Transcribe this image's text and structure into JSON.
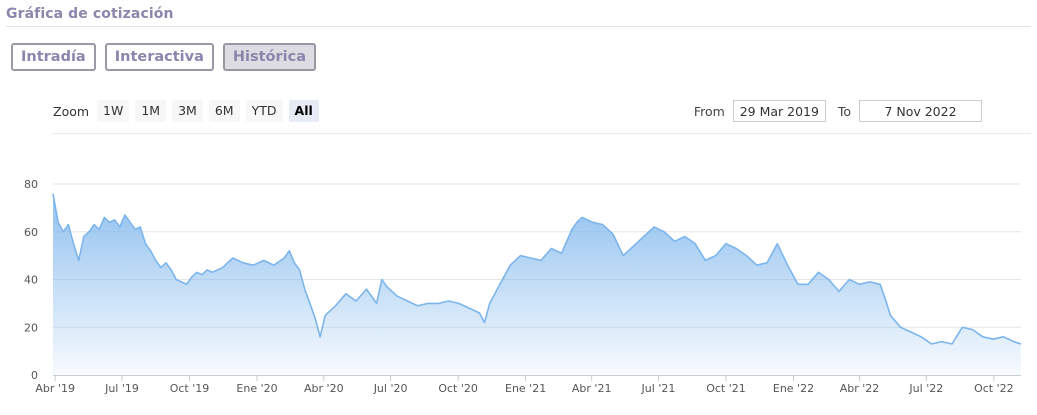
{
  "header": {
    "title": "Gráfica de cotización"
  },
  "tabs": [
    {
      "label": "Intradía",
      "active": false
    },
    {
      "label": "Interactiva",
      "active": false
    },
    {
      "label": "Histórica",
      "active": true
    }
  ],
  "range_selector": {
    "zoom_label": "Zoom",
    "buttons": [
      "1W",
      "1M",
      "3M",
      "6M",
      "YTD",
      "All"
    ],
    "active": "All",
    "from_label": "From",
    "from_value": "29 Mar 2019",
    "to_label": "To",
    "to_value": "7 Nov 2022"
  },
  "colors": {
    "line": "#7cb5ec",
    "fill_top": "#7cb5ec",
    "grid": "#e6e6e6",
    "accent": "#8c86ad"
  },
  "chart_data": {
    "type": "area",
    "title": "",
    "xlabel": "",
    "ylabel": "",
    "ylim": [
      0,
      80
    ],
    "yticks": [
      0,
      20,
      40,
      60,
      80
    ],
    "grid": true,
    "xlim": [
      "2019-03-29",
      "2022-11-07"
    ],
    "xticks": [
      {
        "date": "2019-04-01",
        "label": "Abr '19"
      },
      {
        "date": "2019-07-01",
        "label": "Jul '19"
      },
      {
        "date": "2019-10-01",
        "label": "Oct '19"
      },
      {
        "date": "2020-01-01",
        "label": "Ene '20"
      },
      {
        "date": "2020-04-01",
        "label": "Abr '20"
      },
      {
        "date": "2020-07-01",
        "label": "Jul '20"
      },
      {
        "date": "2020-10-01",
        "label": "Oct '20"
      },
      {
        "date": "2021-01-01",
        "label": "Ene '21"
      },
      {
        "date": "2021-04-01",
        "label": "Abr '21"
      },
      {
        "date": "2021-07-01",
        "label": "Jul '21"
      },
      {
        "date": "2021-10-01",
        "label": "Oct '21"
      },
      {
        "date": "2022-01-01",
        "label": "Ene '22"
      },
      {
        "date": "2022-04-01",
        "label": "Abr '22"
      },
      {
        "date": "2022-07-01",
        "label": "Jul '22"
      },
      {
        "date": "2022-10-01",
        "label": "Oct '22"
      }
    ],
    "series": [
      {
        "x": [
          "2019-03-29",
          "2019-04-05",
          "2019-04-12",
          "2019-04-19",
          "2019-04-26",
          "2019-05-03",
          "2019-05-10",
          "2019-05-17",
          "2019-05-24",
          "2019-05-31",
          "2019-06-07",
          "2019-06-14",
          "2019-06-21",
          "2019-06-28",
          "2019-07-05",
          "2019-07-12",
          "2019-07-19",
          "2019-07-26",
          "2019-08-02",
          "2019-08-09",
          "2019-08-16",
          "2019-08-23",
          "2019-08-30",
          "2019-09-06",
          "2019-09-13",
          "2019-09-20",
          "2019-09-27",
          "2019-10-04",
          "2019-10-11",
          "2019-10-18",
          "2019-10-25",
          "2019-11-01",
          "2019-11-15",
          "2019-11-29",
          "2019-12-13",
          "2019-12-27",
          "2020-01-10",
          "2020-01-24",
          "2020-02-07",
          "2020-02-14",
          "2020-02-21",
          "2020-02-28",
          "2020-03-06",
          "2020-03-13",
          "2020-03-20",
          "2020-03-27",
          "2020-04-03",
          "2020-04-17",
          "2020-05-01",
          "2020-05-15",
          "2020-05-29",
          "2020-06-12",
          "2020-06-19",
          "2020-06-26",
          "2020-07-10",
          "2020-07-24",
          "2020-08-07",
          "2020-08-21",
          "2020-09-04",
          "2020-09-18",
          "2020-10-02",
          "2020-10-16",
          "2020-10-23",
          "2020-10-30",
          "2020-11-06",
          "2020-11-13",
          "2020-11-27",
          "2020-12-11",
          "2020-12-25",
          "2021-01-08",
          "2021-01-22",
          "2021-02-05",
          "2021-02-19",
          "2021-03-05",
          "2021-03-12",
          "2021-03-19",
          "2021-04-02",
          "2021-04-16",
          "2021-04-30",
          "2021-05-14",
          "2021-05-28",
          "2021-06-11",
          "2021-06-25",
          "2021-07-09",
          "2021-07-23",
          "2021-08-06",
          "2021-08-20",
          "2021-09-03",
          "2021-09-17",
          "2021-10-01",
          "2021-10-15",
          "2021-10-29",
          "2021-11-12",
          "2021-11-26",
          "2021-12-10",
          "2021-12-24",
          "2022-01-07",
          "2022-01-21",
          "2022-02-04",
          "2022-02-18",
          "2022-03-04",
          "2022-03-18",
          "2022-04-01",
          "2022-04-15",
          "2022-04-29",
          "2022-05-06",
          "2022-05-13",
          "2022-05-27",
          "2022-06-10",
          "2022-06-24",
          "2022-07-08",
          "2022-07-22",
          "2022-08-05",
          "2022-08-19",
          "2022-09-02",
          "2022-09-16",
          "2022-09-30",
          "2022-10-14",
          "2022-10-28",
          "2022-11-07"
        ],
        "values": [
          76,
          64,
          60,
          63,
          55,
          48,
          58,
          60,
          63,
          61,
          66,
          64,
          65,
          62,
          67,
          64,
          61,
          62,
          55,
          52,
          48,
          45,
          47,
          44,
          40,
          39,
          38,
          41,
          43,
          42,
          44,
          43,
          45,
          49,
          47,
          46,
          48,
          46,
          49,
          52,
          47,
          44,
          36,
          30,
          24,
          16,
          25,
          29,
          34,
          31,
          36,
          30,
          40,
          37,
          33,
          31,
          29,
          30,
          30,
          31,
          30,
          28,
          27,
          26,
          22,
          30,
          38,
          46,
          50,
          49,
          48,
          53,
          51,
          61,
          64,
          66,
          64,
          63,
          59,
          50,
          54,
          58,
          62,
          60,
          56,
          58,
          55,
          48,
          50,
          55,
          53,
          50,
          46,
          47,
          55,
          46,
          38,
          38,
          43,
          40,
          35,
          40,
          38,
          39,
          38,
          32,
          25,
          20,
          18,
          16,
          13,
          14,
          13,
          20,
          19,
          16,
          15,
          16,
          14,
          13
        ]
      }
    ]
  }
}
